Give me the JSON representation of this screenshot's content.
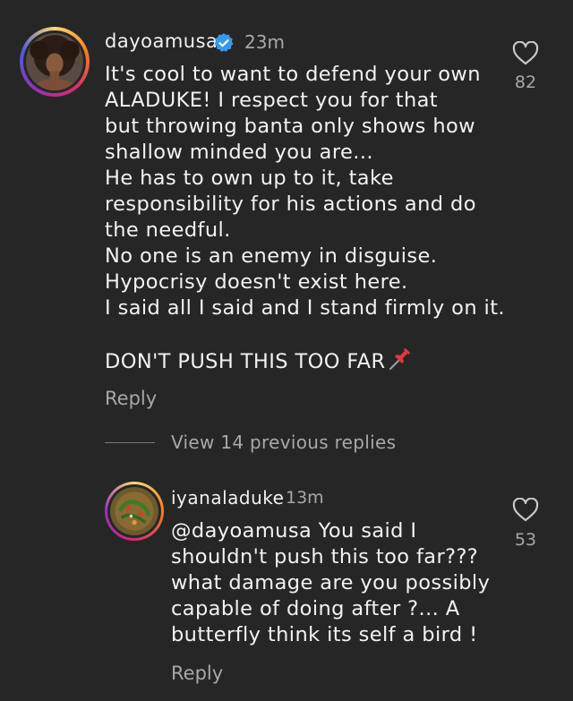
{
  "main_comment": {
    "username": "dayoamusa",
    "time": "23m",
    "lines": [
      "It's cool to want to defend your own",
      "ALADUKE!  I respect you for that",
      "but throwing banta only shows how",
      "shallow minded you are...",
      "He has to own up to it, take",
      "responsibility for his actions and do",
      "the needful.",
      "No one is an enemy in disguise.",
      "Hypocrisy doesn't exist here.",
      "I said all I said and I stand firmly on it.",
      "",
      "DON'T PUSH THIS TOO FAR"
    ],
    "reply_label": "Reply",
    "likes": "82"
  },
  "view_replies_label": "View 14 previous replies",
  "reply_comment": {
    "username": "iyanaladuke",
    "time": "13m",
    "lines": [
      "@dayoamusa You said I",
      "shouldn't push this too far???",
      "what damage are you possibly",
      "capable of doing after ?... A",
      "butterfly think its self a bird !"
    ],
    "reply_label": "Reply",
    "likes": "53"
  },
  "icons": {
    "verified": "verified-badge-icon",
    "heart": "heart-outline-icon",
    "pin": "pushpin-emoji-icon"
  },
  "colors": {
    "background": "#262626",
    "text": "#f2f2f2",
    "muted": "#a8a8a8",
    "verified_blue": "#3897f0"
  }
}
